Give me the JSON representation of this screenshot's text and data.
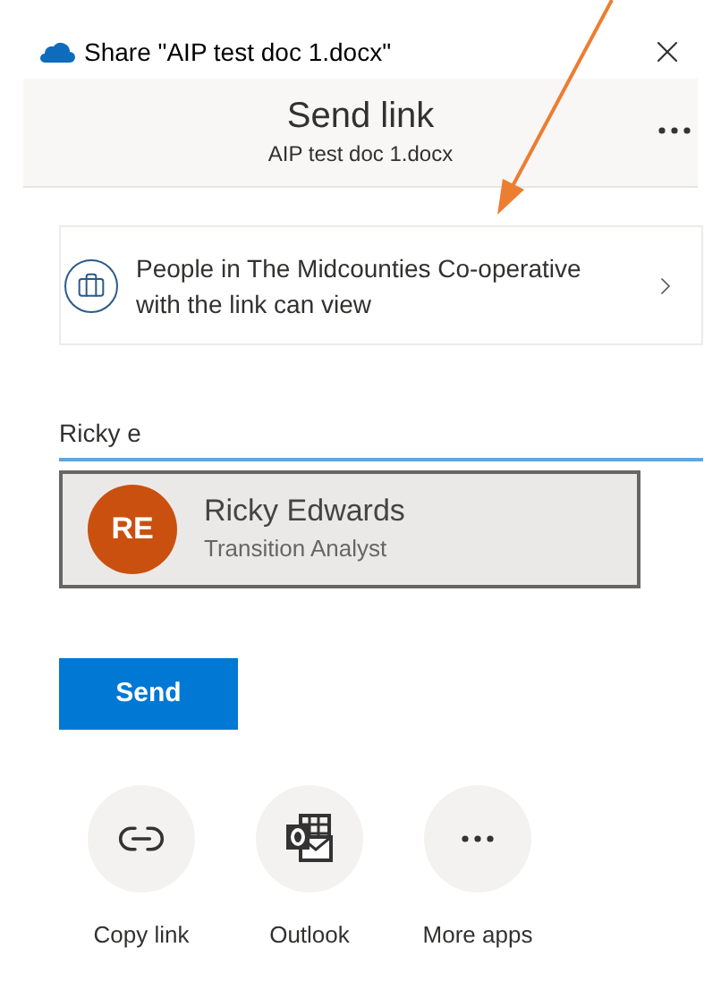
{
  "window": {
    "title": "Share \"AIP test doc 1.docx\""
  },
  "header": {
    "title": "Send link",
    "subtitle": "AIP test doc 1.docx"
  },
  "permission": {
    "text": "People in The Midcounties Co-operative with the link can view"
  },
  "recipient_field": {
    "value": "Ricky e"
  },
  "suggestions": [
    {
      "initials": "RE",
      "name": "Ricky Edwards",
      "role": "Transition Analyst",
      "color": "#ca5010",
      "selected": true
    }
  ],
  "send_button": "Send",
  "share_targets": [
    {
      "kind": "link",
      "label": "Copy link"
    },
    {
      "kind": "outlook",
      "label": "Outlook"
    },
    {
      "kind": "more",
      "label": "More apps"
    }
  ]
}
